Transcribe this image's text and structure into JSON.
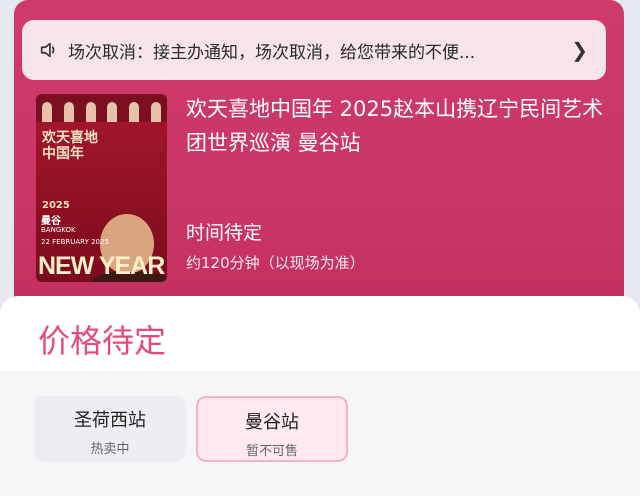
{
  "notice": {
    "text": "场次取消：接主办通知，场次取消，给您带来的不便...",
    "icon": "speaker-icon",
    "chevron_icon": "chevron-right-icon"
  },
  "poster": {
    "title": "欢天喜地中国年",
    "year": "2025",
    "city": "曼谷",
    "city_en": "BANGKOK",
    "date": "22 FEBRUARY 2025",
    "banner": "NEW YEAR"
  },
  "event": {
    "title": "欢天喜地中国年 2025赵本山携辽宁民间艺术团世界巡演 曼谷站",
    "time": "时间待定",
    "duration": "约120分钟（以现场为准）"
  },
  "price": {
    "label": "价格待定",
    "color": "#e54b7a"
  },
  "sessions": [
    {
      "name": "圣荷西站",
      "status": "热卖中",
      "selected": false
    },
    {
      "name": "曼谷站",
      "status": "暂不可售",
      "selected": true
    }
  ],
  "colors": {
    "card_bg": "#c93565",
    "notice_bg": "#f7e4ea",
    "accent": "#e54b7a"
  }
}
